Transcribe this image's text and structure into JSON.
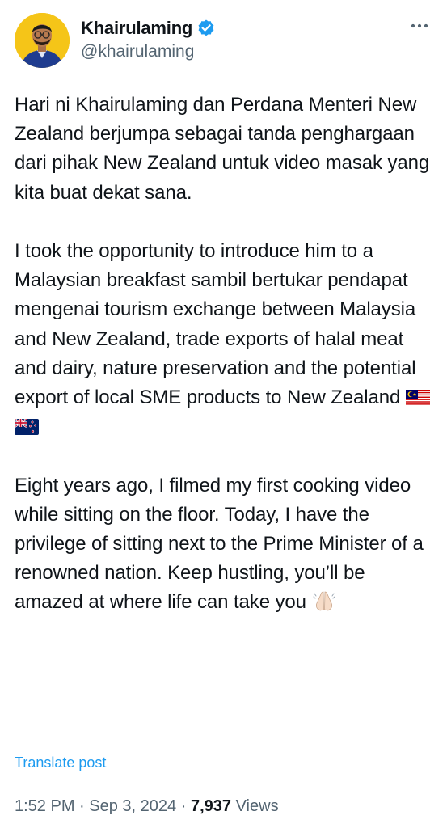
{
  "author": {
    "display_name": "Khairulaming",
    "handle": "@khairulaming",
    "verified": true,
    "avatar_icon": "avatar-photo"
  },
  "more_icon": "more-horizontal-icon",
  "post": {
    "paragraph_1": "Hari ni Khairulaming dan Perdana Menteri New Zealand berjumpa sebagai tanda penghargaan dari pihak New Zealand untuk video masak yang kita buat dekat sana.",
    "paragraph_2": "I took the opportunity to introduce him to a Malaysian breakfast sambil bertukar pendapat mengenai tourism exchange between Malaysia and New Zealand, trade exports of halal meat and dairy, nature preservation and the potential export of local SME products to New Zealand",
    "paragraph_2_emoji": [
      "malaysia-flag-icon",
      "new-zealand-flag-icon"
    ],
    "paragraph_3": "Eight years ago, I filmed my first cooking video while sitting on the floor. Today, I have the privilege of sitting next to the Prime Minister of a renowned nation. Keep hustling, you’ll be amazed at where life can take you",
    "paragraph_3_emoji": "folded-hands-icon"
  },
  "translate_label": "Translate post",
  "meta": {
    "time": "1:52 PM",
    "separator": "·",
    "date": "Sep 3, 2024",
    "views_count": "7,937",
    "views_label": "Views"
  },
  "colors": {
    "text": "#0f1419",
    "secondary": "#536471",
    "accent": "#1d9bf0"
  }
}
